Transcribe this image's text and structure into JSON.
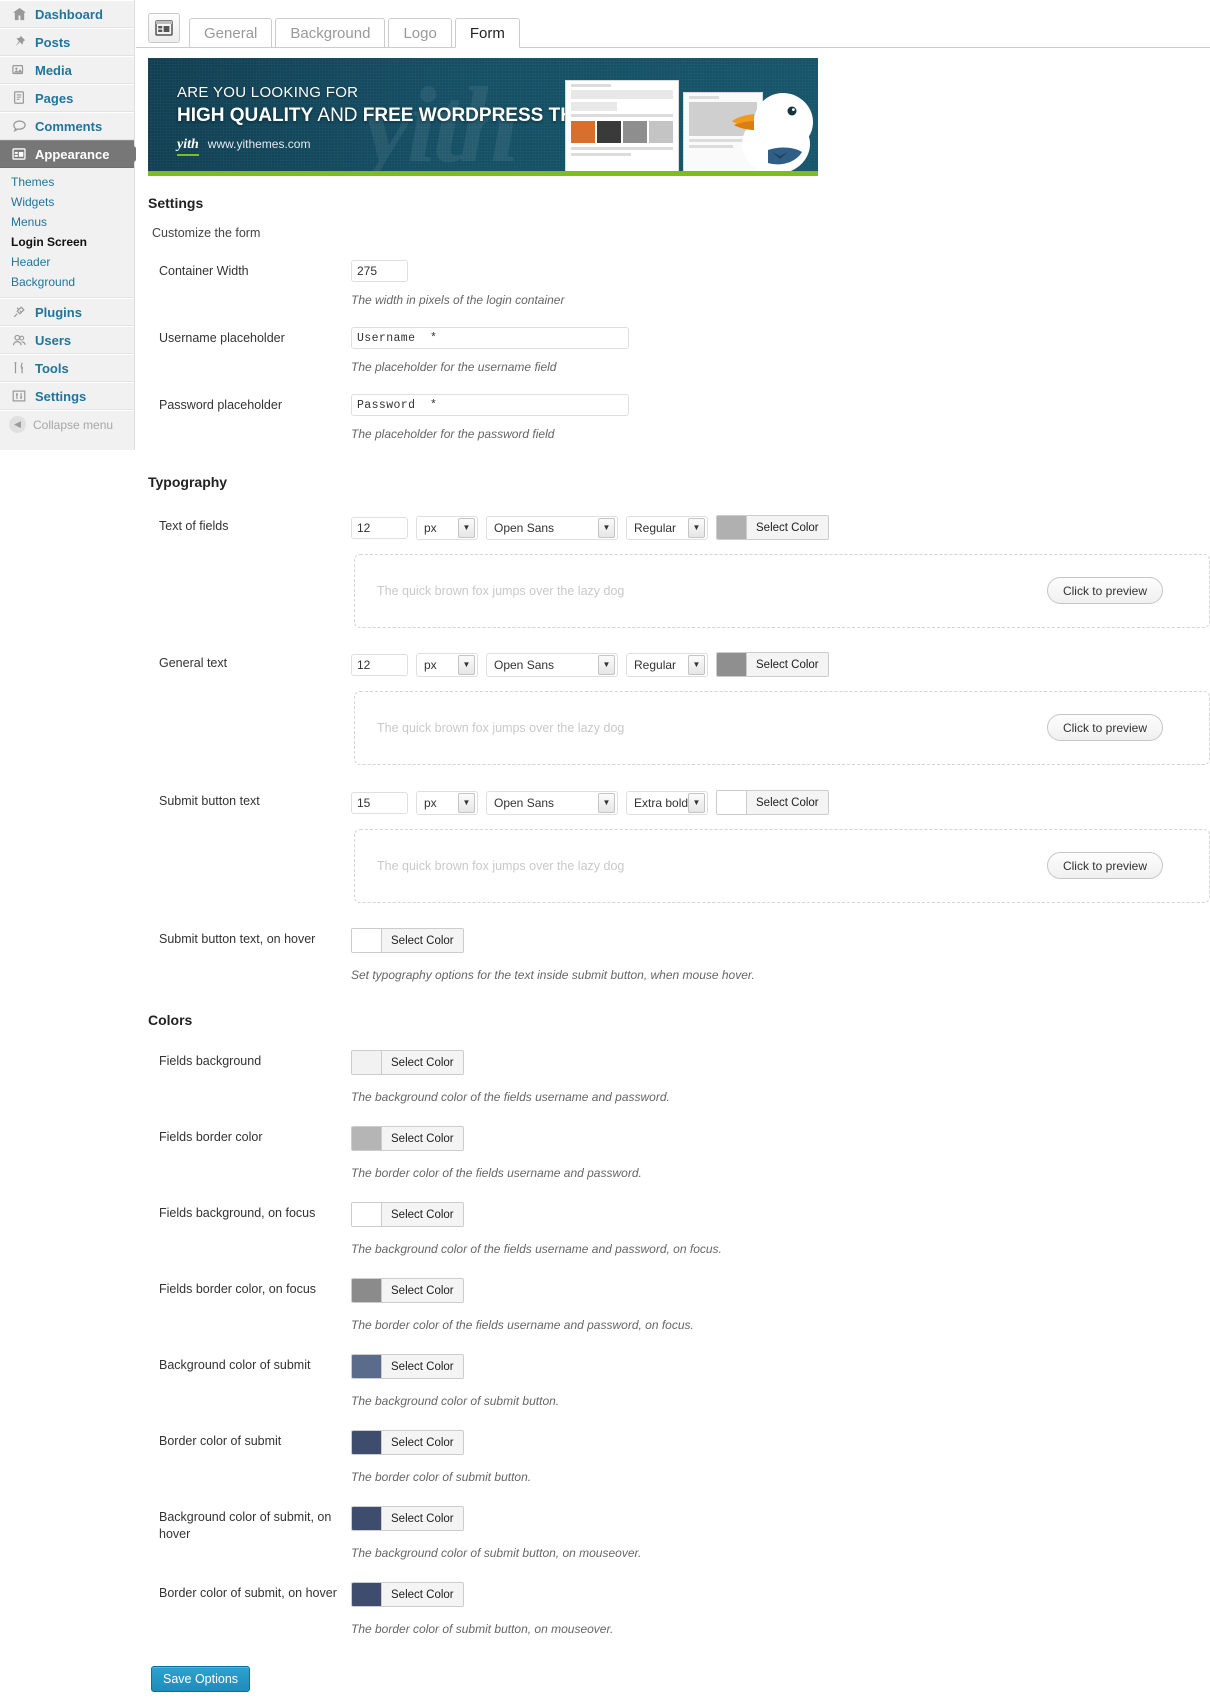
{
  "sidebar": {
    "items": [
      {
        "label": "Dashboard",
        "icon": "dashboard-icon"
      },
      {
        "label": "Posts",
        "icon": "pin-icon"
      },
      {
        "label": "Media",
        "icon": "media-icon"
      },
      {
        "label": "Pages",
        "icon": "pages-icon"
      },
      {
        "label": "Comments",
        "icon": "comment-icon"
      },
      {
        "label": "Appearance",
        "icon": "appearance-icon",
        "current": true
      },
      {
        "label": "Plugins",
        "icon": "plugin-icon"
      },
      {
        "label": "Users",
        "icon": "users-icon"
      },
      {
        "label": "Tools",
        "icon": "tools-icon"
      },
      {
        "label": "Settings",
        "icon": "settings-icon"
      }
    ],
    "submenu": [
      {
        "label": "Themes"
      },
      {
        "label": "Widgets"
      },
      {
        "label": "Menus"
      },
      {
        "label": "Login Screen",
        "active": true
      },
      {
        "label": "Header"
      },
      {
        "label": "Background"
      }
    ],
    "collapse_label": "Collapse menu"
  },
  "tabs": [
    {
      "label": "General",
      "active": false
    },
    {
      "label": "Background",
      "active": false
    },
    {
      "label": "Logo",
      "active": false
    },
    {
      "label": "Form",
      "active": true
    }
  ],
  "banner": {
    "line1": "ARE YOU LOOKING FOR",
    "line2_strong_a": "HIGH QUALITY",
    "line2_plain": " AND ",
    "line2_strong_b": "FREE WORDPRESS THEMES?",
    "logo": "yith",
    "url": "www.yithemes.com"
  },
  "settings": {
    "heading": "Settings",
    "description": "Customize the form",
    "container_width": {
      "label": "Container Width",
      "value": "275",
      "hint": "The width in pixels of the login container"
    },
    "username_placeholder": {
      "label": "Username placeholder",
      "value": "Username  *",
      "hint": "The placeholder for the username field"
    },
    "password_placeholder": {
      "label": "Password placeholder",
      "value": "Password  *",
      "hint": "The placeholder for the password field"
    }
  },
  "typography": {
    "heading": "Typography",
    "preview_text": "The quick brown fox jumps over the lazy dog",
    "preview_button": "Click to preview",
    "select_color_label": "Select Color",
    "rows": [
      {
        "label": "Text of fields",
        "size": "12",
        "unit": "px",
        "family": "Open Sans",
        "weight": "Regular",
        "color": "#b0b0b0"
      },
      {
        "label": "General text",
        "size": "12",
        "unit": "px",
        "family": "Open Sans",
        "weight": "Regular",
        "color": "#8f8f8f"
      },
      {
        "label": "Submit button text",
        "size": "15",
        "unit": "px",
        "family": "Open Sans",
        "weight": "Extra bold",
        "color": "#ffffff"
      }
    ],
    "hover_row": {
      "label": "Submit button text, on hover",
      "color": "#ffffff",
      "hint": "Set typography options for the text inside submit button, when mouse hover."
    }
  },
  "colors": {
    "heading": "Colors",
    "select_color_label": "Select Color",
    "rows": [
      {
        "label": "Fields background",
        "color": "#f2f2f2",
        "hint": "The background color of the fields username and password."
      },
      {
        "label": "Fields border color",
        "color": "#b5b5b5",
        "hint": "The border color of the fields username and password."
      },
      {
        "label": "Fields background, on focus",
        "color": "#ffffff",
        "hint": "The background color of the fields username and password, on focus."
      },
      {
        "label": "Fields border color, on focus",
        "color": "#8b8b8b",
        "hint": "The border color of the fields username and password, on focus."
      },
      {
        "label": "Background color of submit",
        "color": "#5b6b8c",
        "hint": "The background color of submit button."
      },
      {
        "label": "Border color of submit",
        "color": "#3e4c6e",
        "hint": "The border color of submit button."
      },
      {
        "label": "Background color of submit, on hover",
        "color": "#3e4c6e",
        "hint": "The background color of submit button, on mouseover."
      },
      {
        "label": "Border color of submit, on hover",
        "color": "#3e4c6e",
        "hint": "The border color of submit button, on mouseover."
      }
    ]
  },
  "footer": {
    "save_label": "Save Options"
  }
}
